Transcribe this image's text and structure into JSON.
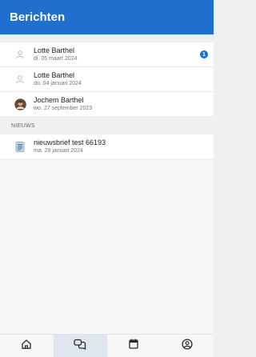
{
  "header": {
    "title": "Berichten"
  },
  "messages": [
    {
      "name": "Lotte Barthel",
      "date": "di. 05 maart 2024",
      "avatar_icon": "user-placeholder-icon",
      "unread": "1"
    },
    {
      "name": "Lotte Barthel",
      "date": "do. 04 januari 2024",
      "avatar_icon": "user-placeholder-icon"
    },
    {
      "name": "Jochem Barthel",
      "date": "wo. 27 september 2023",
      "avatar_icon": "user-photo-icon"
    }
  ],
  "news_section": {
    "label": "NIEUWS",
    "items": [
      {
        "title": "nieuwsbrief test 66193",
        "date": "ma. 29 januari 2024",
        "icon": "newsletter-icon"
      }
    ]
  },
  "tabbar": {
    "tabs": [
      {
        "icon": "home-icon",
        "active": false
      },
      {
        "icon": "chat-icon",
        "active": true
      },
      {
        "icon": "calendar-icon",
        "active": false
      },
      {
        "icon": "profile-icon",
        "active": false
      }
    ]
  },
  "colors": {
    "accent": "#1f6fcf",
    "badge": "#1f6fcf"
  }
}
